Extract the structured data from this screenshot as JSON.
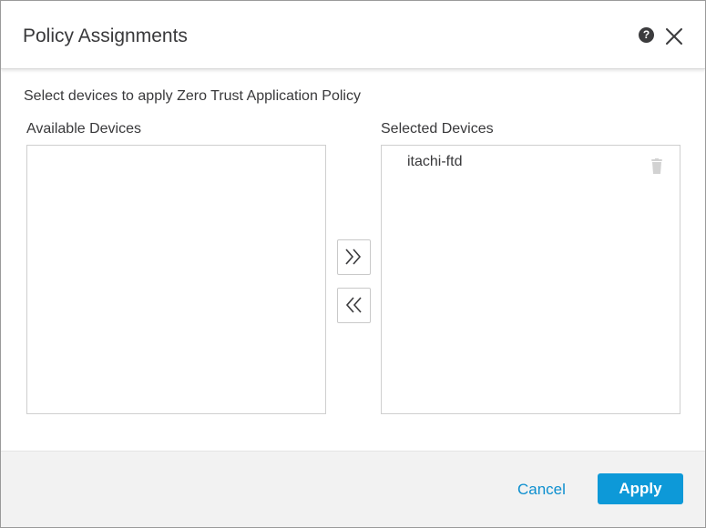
{
  "dialog": {
    "title": "Policy Assignments",
    "help_icon": "question-circle-icon",
    "help_glyph": "?",
    "close_icon": "close-x-icon"
  },
  "instructions": "Select devices to apply Zero Trust Application Policy",
  "available": {
    "label": "Available Devices",
    "items": []
  },
  "selected": {
    "label": "Selected Devices",
    "items": [
      {
        "label": "itachi-ftd",
        "icon": "trash-icon"
      }
    ]
  },
  "move_buttons": {
    "add_all_icon": "double-chevron-right-icon",
    "remove_all_icon": "double-chevron-left-icon"
  },
  "footer": {
    "cancel_label": "Cancel",
    "apply_label": "Apply"
  },
  "colors": {
    "accent": "#0d99d8",
    "link": "#0d8fcf",
    "text": "#39393b",
    "footer_bg": "#f2f2f2"
  }
}
